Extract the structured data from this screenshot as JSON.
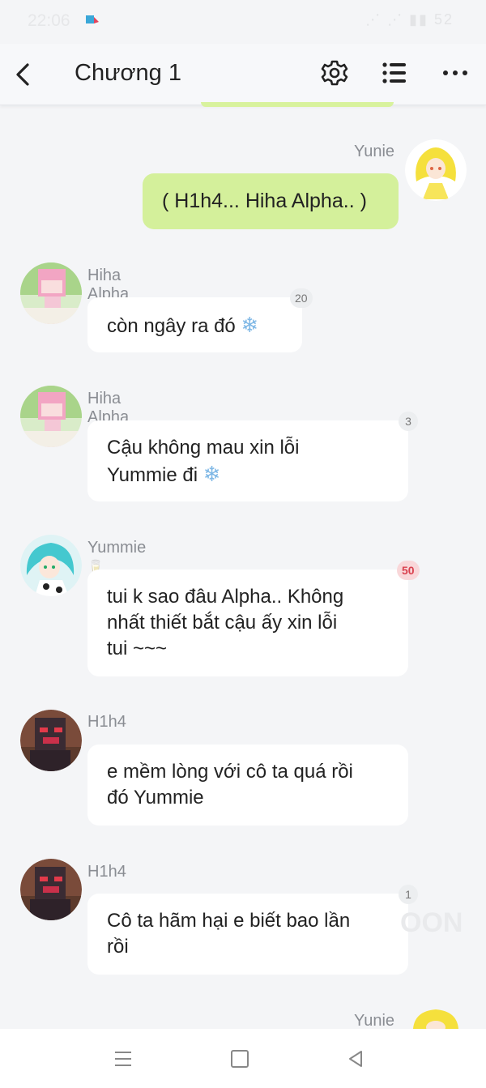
{
  "status_bar": {
    "time": "22:06",
    "right_text": "⋰ ⋰ ▮▮ 52"
  },
  "header": {
    "back_icon": "chevron-left-icon",
    "title": "Chương 1",
    "settings_icon": "gear-icon",
    "list_icon": "list-icon",
    "more_icon": "more-dots-icon"
  },
  "messages": [
    {
      "sender": "Yunie",
      "text": "( H1h4... Hiha Alpha.. )",
      "mine": true
    },
    {
      "sender": "Hiha Alpha",
      "text": "còn ngây ra đó",
      "emoji": "❄",
      "badge": "20"
    },
    {
      "sender": "Hiha Alpha",
      "line1": "Cậu không mau xin lỗi",
      "line2": "Yummie đi",
      "emoji": "❄",
      "badge": "3"
    },
    {
      "sender": "Yummie",
      "sender_emoji": "🥛",
      "line1": "tui k sao đâu Alpha.. Không",
      "line2": "nhất thiết bắt cậu ấy xin lỗi",
      "line3": "tui ~~~",
      "badge": "50"
    },
    {
      "sender": "H1h4",
      "line1": "e mềm lòng với cô ta quá rồi",
      "line2": "đó Yummie"
    },
    {
      "sender": "H1h4",
      "line1": "Cô ta hãm hại e biết bao lần",
      "line2": "rồi",
      "badge": "1"
    },
    {
      "sender": "Yunie"
    }
  ],
  "watermark": "OON",
  "colors": {
    "accent_bubble": "#d4f09b",
    "hot_badge": "#d9424f"
  }
}
